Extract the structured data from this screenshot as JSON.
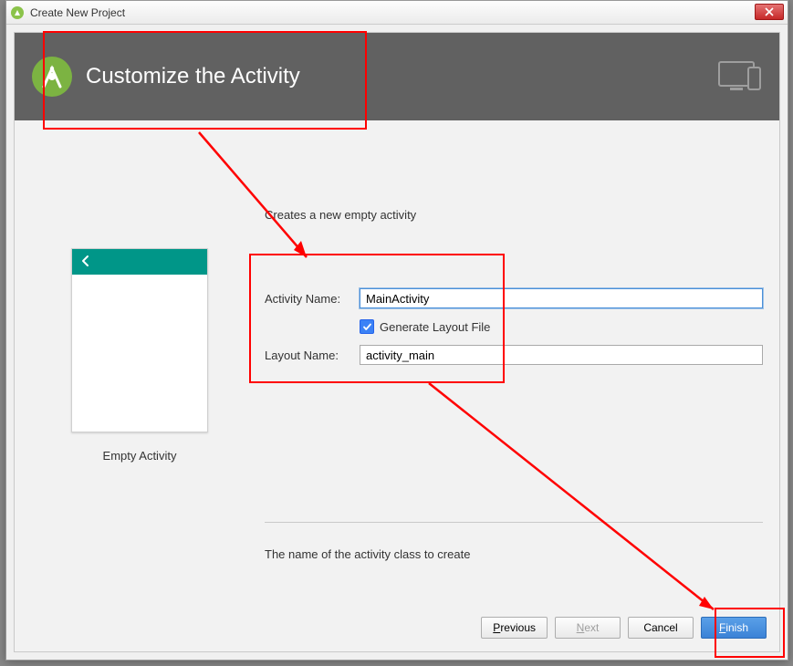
{
  "window": {
    "title": "Create New Project"
  },
  "header": {
    "title": "Customize the Activity"
  },
  "description": "Creates a new empty activity",
  "preview": {
    "caption": "Empty Activity"
  },
  "form": {
    "activity_name_label": "Activity Name:",
    "activity_name_value": "MainActivity",
    "generate_layout_label": "Generate Layout File",
    "generate_layout_checked": true,
    "layout_name_label": "Layout Name:",
    "layout_name_value": "activity_main"
  },
  "help_text": "The name of the activity class to create",
  "buttons": {
    "previous_prefix": "P",
    "previous_rest": "revious",
    "next_prefix": "N",
    "next_rest": "ext",
    "cancel": "Cancel",
    "finish_prefix": "F",
    "finish_rest": "inish"
  }
}
